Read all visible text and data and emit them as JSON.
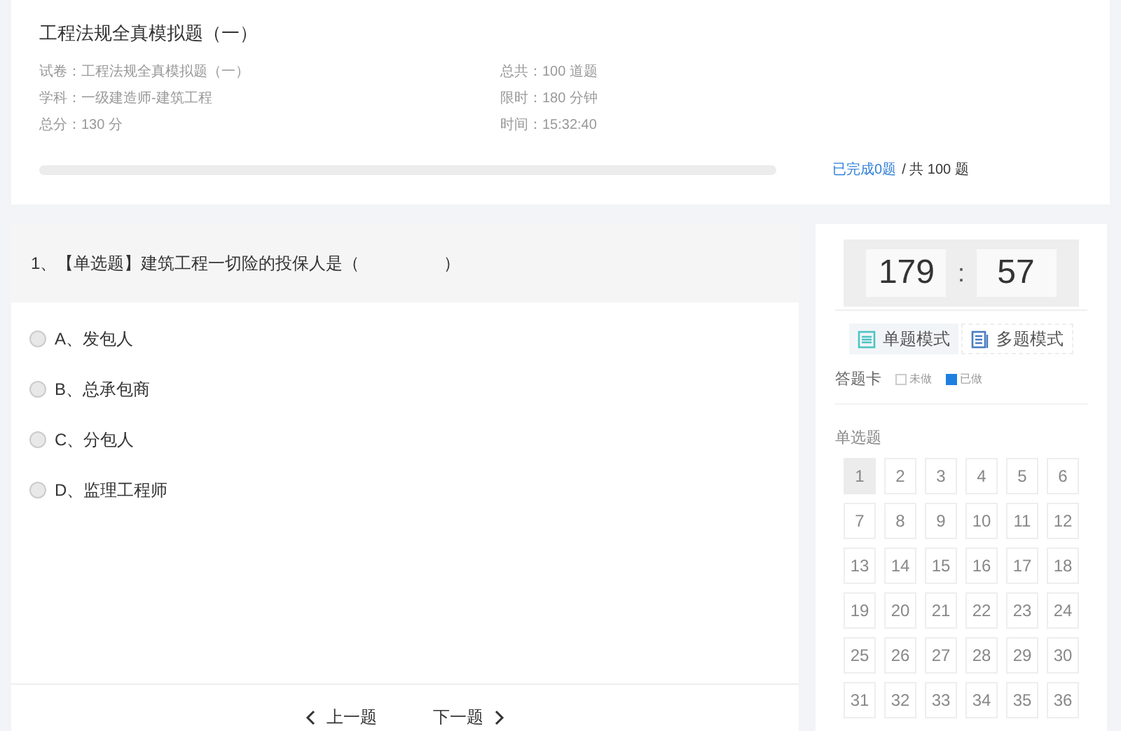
{
  "exam_title": "工程法规全真模拟题（一）",
  "info_left": [
    {
      "label": "试卷：",
      "value": "工程法规全真模拟题（一）"
    },
    {
      "label": "学科：",
      "value": "一级建造师-建筑工程"
    },
    {
      "label": "总分：",
      "value": "130 分"
    }
  ],
  "info_right": [
    {
      "label": "总共：",
      "value": "100 道题"
    },
    {
      "label": "限时：",
      "value": "180 分钟"
    },
    {
      "label": "时间：",
      "value": "15:32:40"
    }
  ],
  "progress": {
    "done": "已完成0题",
    "total": "/ 共 100 题"
  },
  "question": {
    "text": "1、【单选题】建筑工程一切险的投保人是（　　　　　）",
    "options": [
      {
        "text": "A、发包人",
        "checked": false
      },
      {
        "text": "B、总承包商",
        "checked": false
      },
      {
        "text": "C、分包人",
        "checked": false
      },
      {
        "text": "D、监理工程师",
        "checked": false
      }
    ]
  },
  "nav": {
    "prev": "上一题",
    "next": "下一题"
  },
  "timer": {
    "minutes": "179",
    "separator": ":",
    "seconds": "57"
  },
  "modes": [
    {
      "label": "单题模式",
      "selected": true
    },
    {
      "label": "多题模式",
      "selected": false
    }
  ],
  "answer_card": {
    "title": "答题卡",
    "legend": [
      {
        "label": "未做",
        "kind": "empty"
      },
      {
        "label": "已做",
        "kind": "done"
      }
    ],
    "section": "单选题",
    "numbers": [
      {
        "label": "1",
        "selected": true
      },
      {
        "label": "2",
        "selected": false
      },
      {
        "label": "3",
        "selected": false
      },
      {
        "label": "4",
        "selected": false
      },
      {
        "label": "5",
        "selected": false
      },
      {
        "label": "6",
        "selected": false
      },
      {
        "label": "7",
        "selected": false
      },
      {
        "label": "8",
        "selected": false
      },
      {
        "label": "9",
        "selected": false
      },
      {
        "label": "10",
        "selected": false
      },
      {
        "label": "11",
        "selected": false
      },
      {
        "label": "12",
        "selected": false
      },
      {
        "label": "13",
        "selected": false
      },
      {
        "label": "14",
        "selected": false
      },
      {
        "label": "15",
        "selected": false
      },
      {
        "label": "16",
        "selected": false
      },
      {
        "label": "17",
        "selected": false
      },
      {
        "label": "18",
        "selected": false
      },
      {
        "label": "19",
        "selected": false
      },
      {
        "label": "20",
        "selected": false
      },
      {
        "label": "21",
        "selected": false
      },
      {
        "label": "22",
        "selected": false
      },
      {
        "label": "23",
        "selected": false
      },
      {
        "label": "24",
        "selected": false
      },
      {
        "label": "25",
        "selected": false
      },
      {
        "label": "26",
        "selected": false
      },
      {
        "label": "27",
        "selected": false
      },
      {
        "label": "28",
        "selected": false
      },
      {
        "label": "29",
        "selected": false
      },
      {
        "label": "30",
        "selected": false
      },
      {
        "label": "31",
        "selected": false
      },
      {
        "label": "32",
        "selected": false
      },
      {
        "label": "33",
        "selected": false
      },
      {
        "label": "34",
        "selected": false
      },
      {
        "label": "35",
        "selected": false
      },
      {
        "label": "36",
        "selected": false
      }
    ]
  }
}
